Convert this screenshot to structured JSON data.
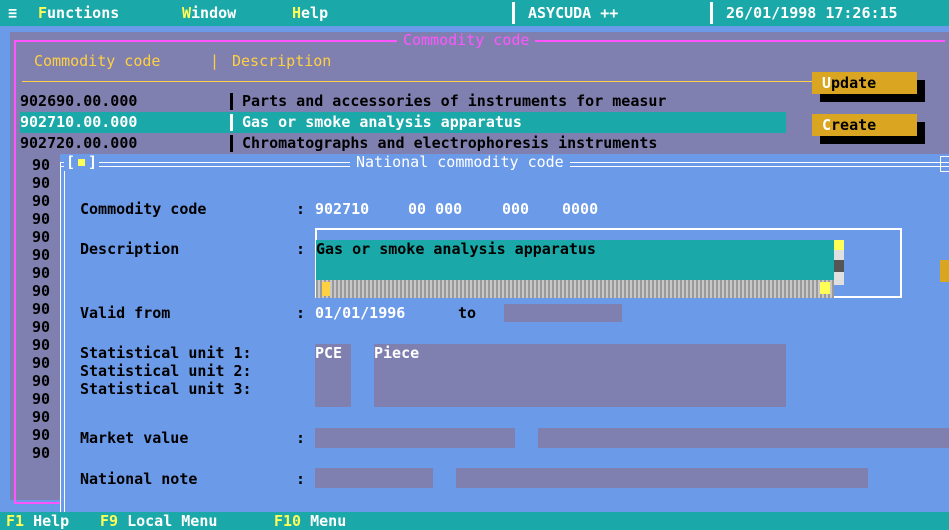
{
  "menubar": {
    "system_icon": "≡",
    "items": [
      {
        "hot": "F",
        "rest": "unctions"
      },
      {
        "hot": "W",
        "rest": "indow"
      },
      {
        "hot": "H",
        "rest": "elp"
      }
    ],
    "app_name": "ASYCUDA ++",
    "datetime": "26/01/1998 17:26:15"
  },
  "commodity_window": {
    "title": "Commodity code",
    "col_code": "Commodity code",
    "col_sep": "|",
    "col_desc": "Description",
    "rows": [
      {
        "code": "902690.00.000",
        "desc": "Parts and accessories of instruments for measur"
      },
      {
        "code": "902710.00.000",
        "desc": "Gas or smoke analysis apparatus",
        "selected": true
      },
      {
        "code": "902720.00.000",
        "desc": "Chromatographs and electrophoresis instruments"
      }
    ],
    "gutter": [
      "90",
      "90",
      "90",
      "90",
      "90",
      "90",
      "90",
      "90",
      "90",
      "90",
      "90",
      "90",
      "90",
      "90",
      "90",
      "90",
      "90"
    ],
    "update_button": {
      "hot": "U",
      "rest": "pdate"
    },
    "create_button": {
      "hot": "C",
      "rest": "reate"
    }
  },
  "national_window": {
    "close_box": "[■]",
    "title": "National commodity code",
    "commodity_code_label": "Commodity code",
    "commodity_code_parts": [
      "902710",
      "00 000",
      "000",
      "0000"
    ],
    "description_label": "Description",
    "description_value": "Gas or smoke analysis apparatus",
    "valid_from_label": "Valid from",
    "valid_from_value": "01/01/1996",
    "to_label": "to",
    "stat_unit_1_label": "Statistical unit 1:",
    "stat_unit_2_label": "Statistical unit 2:",
    "stat_unit_3_label": "Statistical unit 3:",
    "stat_unit_1_code": "PCE",
    "stat_unit_1_name": "Piece",
    "market_value_label": "Market value",
    "national_note_label": "National note",
    "colon": ":"
  },
  "statusbar": [
    {
      "key": "F1",
      "label": "Help"
    },
    {
      "key": "F9",
      "label": "Local Menu"
    },
    {
      "key": "F10",
      "label": "Menu"
    }
  ]
}
